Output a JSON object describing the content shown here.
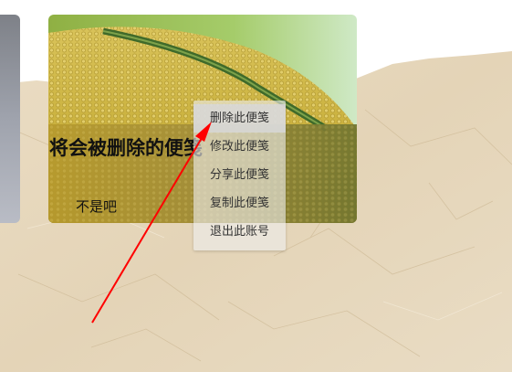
{
  "note": {
    "title": "将会被删除的便笺",
    "content": "不是吧"
  },
  "context_menu": {
    "items": [
      {
        "label": "删除此便笺",
        "active": true
      },
      {
        "label": "修改此便笺",
        "active": false
      },
      {
        "label": "分享此便笺",
        "active": false
      },
      {
        "label": "复制此便笺",
        "active": false
      },
      {
        "label": "退出此账号",
        "active": false
      }
    ]
  },
  "colors": {
    "annotation_arrow": "#ff0000",
    "paper_background": "#e7d8bd",
    "menu_background": "#eeeeee"
  },
  "icons": {
    "annotation": "red-arrow-icon"
  }
}
